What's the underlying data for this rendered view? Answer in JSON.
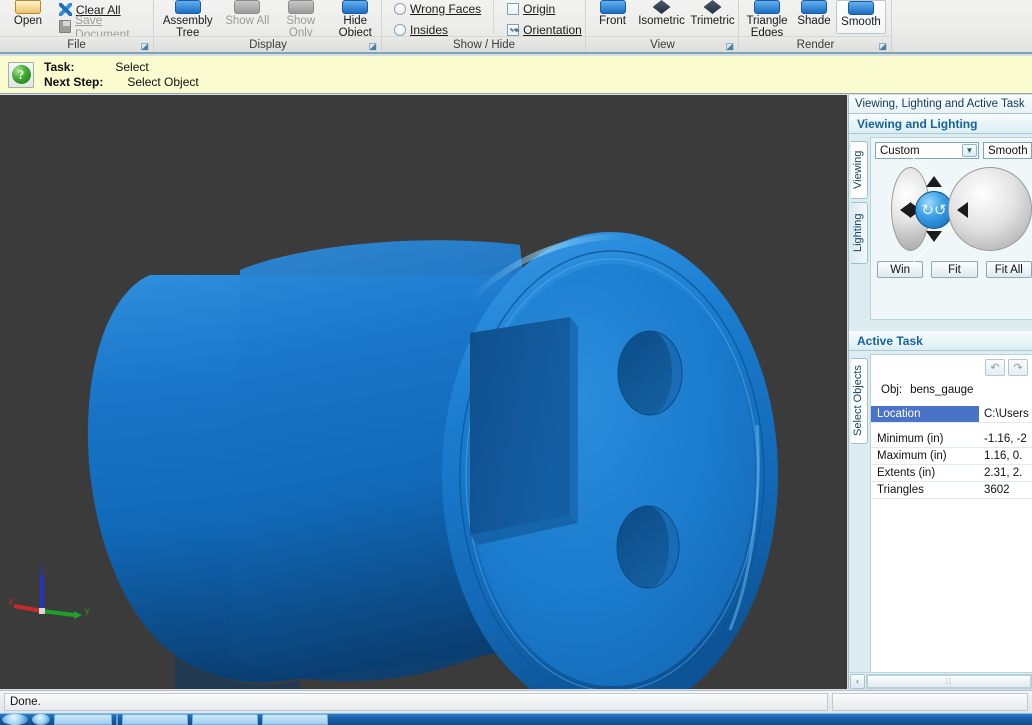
{
  "ribbon": {
    "groups": [
      {
        "title": "File",
        "dialog_launcher": true,
        "big_buttons": [
          {
            "label": "Open",
            "icon": "folder-open-icon",
            "enabled": true
          }
        ],
        "small_buttons": [
          {
            "label": "Clear All",
            "icon": "clear-all-icon",
            "enabled": true
          },
          {
            "label": "Save Document",
            "icon": "save-floppy-icon",
            "enabled": false
          }
        ]
      },
      {
        "title": "Display",
        "dialog_launcher": true,
        "big_buttons": [
          {
            "label": "Assembly Tree",
            "icon": "assembly-tree-icon",
            "enabled": true
          },
          {
            "label": "Show All",
            "icon": "show-all-icon",
            "enabled": false
          },
          {
            "label": "Show Only",
            "icon": "show-only-icon",
            "enabled": false
          },
          {
            "label": "Hide Object",
            "icon": "hide-object-icon",
            "enabled": true
          }
        ]
      },
      {
        "title": "Show / Hide",
        "dialog_launcher": false,
        "options": [
          {
            "label": "Wrong Faces",
            "type": "radio",
            "checked": false
          },
          {
            "label": "Insides",
            "type": "radio",
            "checked": false
          },
          {
            "label": "Origin",
            "type": "checkbox",
            "checked": false
          },
          {
            "label": "Orientation",
            "type": "checkbox",
            "checked": true
          }
        ]
      },
      {
        "title": "View",
        "dialog_launcher": true,
        "big_buttons": [
          {
            "label": "Front",
            "icon": "view-front-icon",
            "enabled": true
          },
          {
            "label": "Isometric",
            "icon": "view-isometric-icon",
            "enabled": true
          },
          {
            "label": "Trimetric",
            "icon": "view-trimetric-icon",
            "enabled": true
          }
        ]
      },
      {
        "title": "Render",
        "dialog_launcher": true,
        "big_buttons": [
          {
            "label": "Triangle Edges",
            "icon": "triangle-edges-icon",
            "enabled": true
          },
          {
            "label": "Shade",
            "icon": "shade-icon",
            "enabled": true
          },
          {
            "label": "Smooth",
            "icon": "smooth-icon",
            "enabled": true,
            "pressed": true
          }
        ]
      }
    ]
  },
  "task_banner": {
    "help_glyph": "?",
    "task_label": "Task:",
    "task_value": "Select",
    "next_step_label": "Next Step:",
    "next_step_value": "Select Object"
  },
  "viewport": {
    "background_color": "#3b3b3b",
    "model_color_light": "#1d7fd4",
    "model_color_dark": "#0a477f",
    "axis_labels": {
      "x": "X",
      "y": "Y",
      "z": "Z"
    },
    "axis_colors": {
      "x": "#c92a2a",
      "y": "#1fa02a",
      "z": "#2433c4"
    }
  },
  "right_panel": {
    "caption": "Viewing, Lighting and Active Task",
    "viewing": {
      "header": "Viewing and Lighting",
      "tabs": [
        {
          "label": "Viewing",
          "active": true
        },
        {
          "label": "Lighting",
          "active": false
        }
      ],
      "combo_left_value": "Custom",
      "combo_right_value": "Smooth",
      "nav_hub_glyph": "↻↺",
      "buttons": [
        "Win",
        "Fit",
        "Fit All"
      ]
    },
    "active_task": {
      "header": "Active Task",
      "tabs": [
        {
          "label": "Select Objects",
          "active": true
        }
      ],
      "undo_glyph": "↶",
      "redo_glyph": "↷",
      "obj_label": "Obj:",
      "obj_value": "bens_gauge",
      "rows": [
        {
          "key": "Location",
          "value": "C:\\Users",
          "selected": true
        },
        {
          "key": "Minimum (in)",
          "value": "-1.16, -2",
          "selected": false
        },
        {
          "key": "Maximum (in)",
          "value": "1.16, 0.",
          "selected": false
        },
        {
          "key": "Extents (in)",
          "value": "2.31, 2.",
          "selected": false
        },
        {
          "key": "Triangles",
          "value": "3602",
          "selected": false
        }
      ]
    },
    "scrollbar": {
      "left_arrow": "‹",
      "grip": "⁞⁞"
    }
  },
  "status_bar": {
    "message": "Done."
  }
}
